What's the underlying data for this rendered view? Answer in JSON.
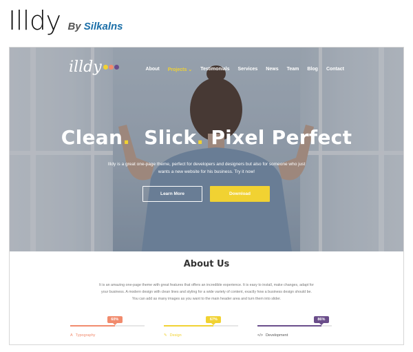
{
  "header": {
    "title": "Illdy",
    "by": "By",
    "author": "Silkalns"
  },
  "site": {
    "logo_text": "illdy",
    "logo_dot_colors": [
      "#f1d232",
      "#f18b6d",
      "#6a4d8a"
    ],
    "nav": [
      {
        "label": "About",
        "active": false
      },
      {
        "label": "Projects ⌄",
        "active": true
      },
      {
        "label": "Testimonials",
        "active": false
      },
      {
        "label": "Services",
        "active": false
      },
      {
        "label": "News",
        "active": false
      },
      {
        "label": "Team",
        "active": false
      },
      {
        "label": "Blog",
        "active": false
      },
      {
        "label": "Contact",
        "active": false
      }
    ],
    "hero": {
      "word1": "Clean",
      "word2": "Slick",
      "word3": "Pixel Perfect",
      "dot": ".",
      "subtext_line1": "Illdy is a great one-page theme, perfect for developers and designers but also for someone who just",
      "subtext_line2": "wants a new website for his business. Try it now!",
      "btn_learn": "Learn More",
      "btn_download": "Download"
    },
    "about": {
      "title": "About Us",
      "line1": "It is an amazing one-page theme with great features that offers an incredible experience. It is easy to install, make changes, adapt for",
      "line2": "your business. A modern design with clean lines and styling for a wide variety of content, exactly how a business design should be.",
      "line3": "You can add as many images as you want to the main header area and turn them into slider.",
      "skills": [
        {
          "percent_label": "60%",
          "value": 0.6,
          "color": "#f18b6d",
          "icon": "font-icon",
          "icon_glyph": "A",
          "label": "Typography"
        },
        {
          "percent_label": "67%",
          "value": 0.67,
          "color": "#f1d232",
          "icon": "pencil-icon",
          "icon_glyph": "✎",
          "label": "Design"
        },
        {
          "percent_label": "86%",
          "value": 0.86,
          "color": "#6a4d8a",
          "icon": "code-icon",
          "icon_glyph": "</>",
          "label": "Development"
        }
      ]
    }
  },
  "colors": {
    "accent_yellow": "#f1d232",
    "accent_coral": "#f18b6d",
    "accent_purple": "#6a4d8a",
    "author_blue": "#1b6fa8"
  }
}
